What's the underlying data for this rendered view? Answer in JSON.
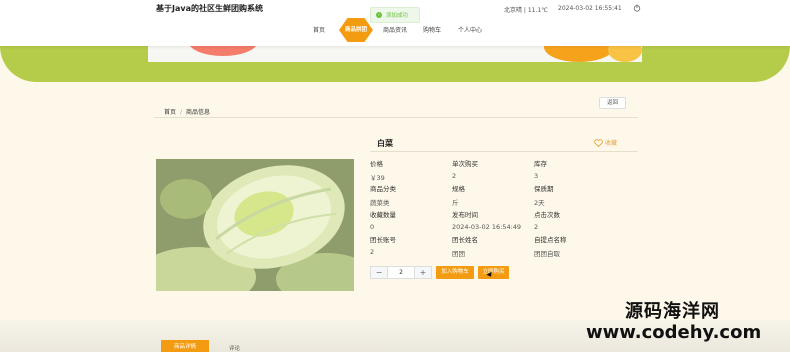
{
  "header": {
    "site_title": "基于Java的社区生鲜团购系统",
    "weather": "北京晴 | 11.1℃",
    "datetime": "2024-03-02  16:55:41",
    "toast": "添加成功",
    "nav": [
      "首页",
      "商品拼团",
      "商品资讯",
      "购物车",
      "个人中心"
    ]
  },
  "breadcrumb": {
    "home": "首页",
    "current": "商品信息"
  },
  "back_label": "返回",
  "product": {
    "title": "白菜",
    "favorite_label": "收藏",
    "attributes": [
      {
        "k": "价格",
        "v": "￥39"
      },
      {
        "k": "单次购买",
        "v": "2"
      },
      {
        "k": "库存",
        "v": "3"
      },
      {
        "k": "商品分类",
        "v": "蔬菜类"
      },
      {
        "k": "规格",
        "v": "斤"
      },
      {
        "k": "保质期",
        "v": "2天"
      },
      {
        "k": "收藏数量",
        "v": "0"
      },
      {
        "k": "发布时间",
        "v": "2024-03-02 16:54:49"
      },
      {
        "k": "点击次数",
        "v": "2"
      },
      {
        "k": "团长账号",
        "v": "2"
      },
      {
        "k": "团长姓名",
        "v": "团团"
      },
      {
        "k": "自提点名称",
        "v": "团团自取"
      }
    ],
    "quantity": "2",
    "add_to_cart_label": "加入购物车",
    "buy_now_label": "立即购买"
  },
  "tabs": [
    "商品详情",
    "评论"
  ],
  "watermark": {
    "line1": "源码海洋网",
    "line2": "www.codehy.com"
  },
  "colors": {
    "accent": "#f39c12",
    "band": "#b5cc4a",
    "success": "#67c23a"
  }
}
